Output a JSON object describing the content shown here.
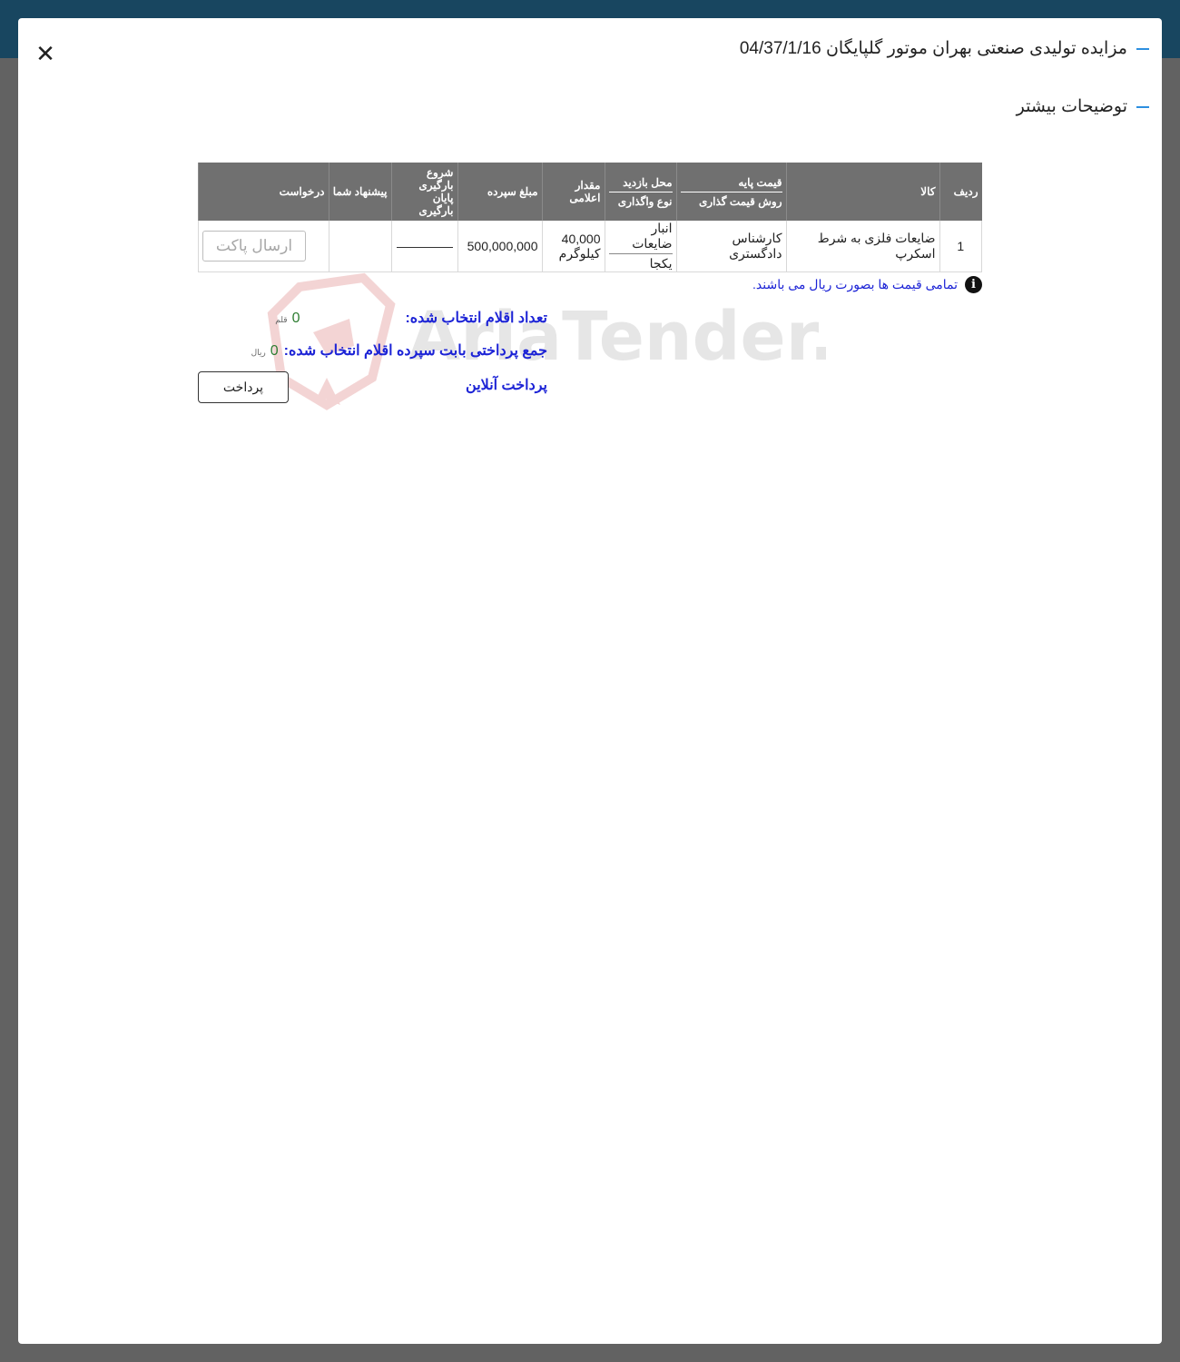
{
  "modal": {
    "close_symbol": "✕",
    "title": "مزایده تولیدی صنعتی بهران موتور گلپایگان 04/37/1/16",
    "section_title": "توضیحات بیشتر"
  },
  "table": {
    "headers": {
      "row": "ردیف",
      "item": "کالا",
      "base_price": "قیمت پایه",
      "pricing_method": "روش قیمت گذاری",
      "visit_location": "محل بازدید",
      "transfer_type": "نوع واگذاری",
      "quantity": "مقدار اعلامی",
      "deposit": "مبلغ سپرده",
      "loading_start": "شروع بارگیری",
      "loading_end": "پایان بارگیری",
      "your_offer": "پیشنهاد شما",
      "request": "درخواست"
    },
    "rows": [
      {
        "row": "1",
        "item": "ضایعات فلزی به شرط اسکرپ",
        "pricing_method": "کارشناس دادگستری",
        "visit_location": "انبار ضایعات",
        "transfer_type": "یکجا",
        "quantity": "40,000",
        "unit": "کیلوگرم",
        "deposit": "500,000,000",
        "button_label": "ارسال پاکت"
      }
    ]
  },
  "notice": {
    "icon": "info-icon",
    "text": "تمامی قیمت ها بصورت ریال می باشند."
  },
  "summary": {
    "count_label": "تعداد اقلام انتخاب شده:",
    "count_value": "0",
    "count_unit": "قلم",
    "payment_label": "جمع پرداختی بابت سپرده اقلام انتخاب شده:",
    "payment_value": "0",
    "payment_unit": "ریال",
    "online_label": "پرداخت آنلاین",
    "pay_button": "پرداخت"
  },
  "watermark": {
    "text": "AriaTender.neT"
  },
  "colors": {
    "header_bg": "#184660",
    "backdrop": "#626262",
    "table_header": "#707070",
    "link_blue": "#1d24d6",
    "accent_dash": "#2d8fe0",
    "value_green": "#2e7d32"
  }
}
